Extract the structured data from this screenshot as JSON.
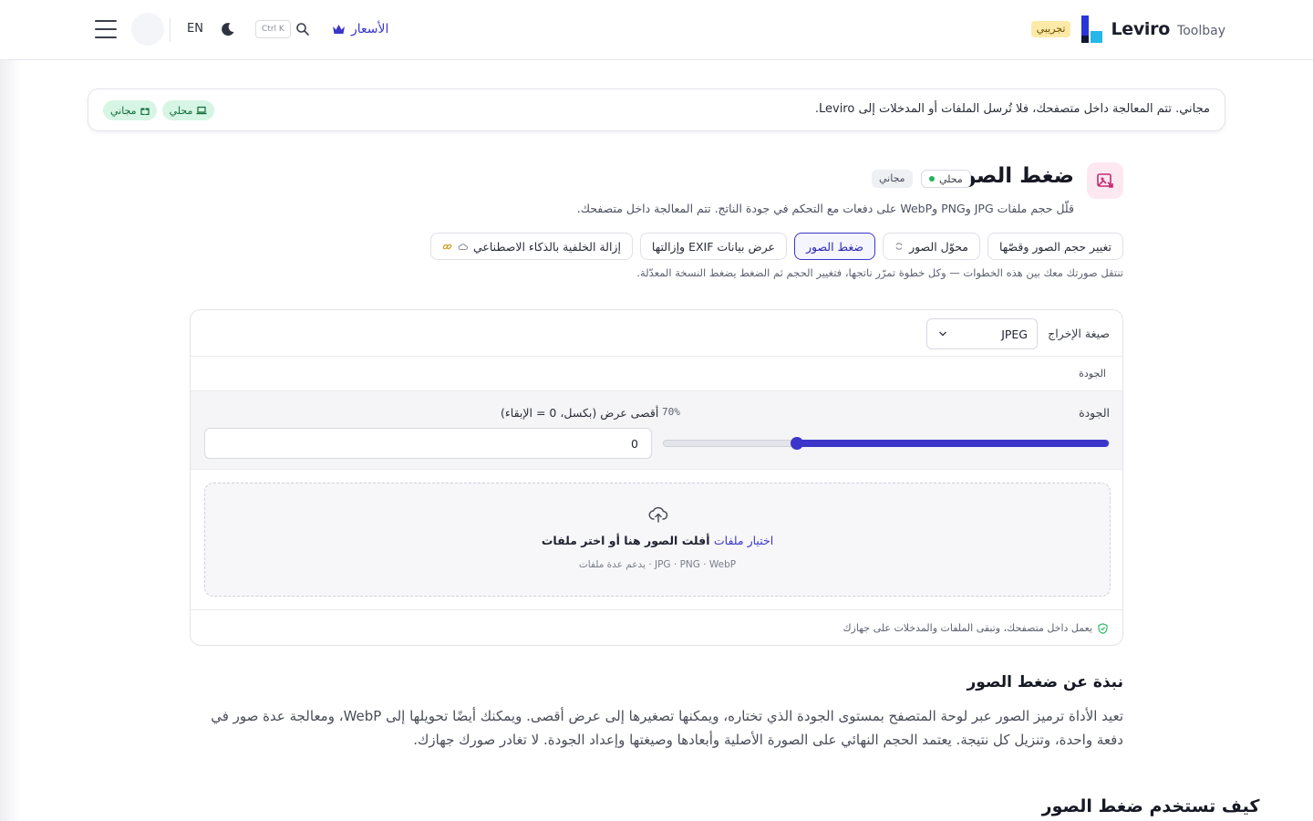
{
  "nav": {
    "lang": "EN",
    "kbd": "Ctrl K",
    "pricing": "الأسعار",
    "brand_name": "Leviro",
    "brand_sub": "Toolbay",
    "trial": "تجريبي"
  },
  "banner": {
    "text": "مجاني. تتم المعالجة داخل متصفحك، فلا تُرسل الملفات أو المدخلات إلى Leviro.",
    "chip_local": "محلي",
    "chip_free": "مجاني"
  },
  "tool": {
    "title": "ضغط الصور",
    "badge_local": "محلي",
    "badge_free": "مجاني",
    "description": "قلّل حجم ملفات JPG وPNG وWebP على دفعات مع التحكم في جودة الناتج. تتم المعالجة داخل متصفحك."
  },
  "steps": [
    {
      "label": "تغيير حجم الصور وقصّها"
    },
    {
      "label": "محوّل الصور"
    },
    {
      "label": "ضغط الصور",
      "active": true
    },
    {
      "label": "عرض بيانات EXIF وإزالتها"
    },
    {
      "label": "إزالة الخلفية بالذكاء الاصطناعي"
    }
  ],
  "steps_note": "تنتقل صورتك معك بين هذه الخطوات — وكل خطوة تمرّر ناتجها، فتغيير الحجم ثم الضغط يضغط النسخة المعدّلة.",
  "settings": {
    "format_label": "صيغة الإخراج",
    "format_value": "JPEG",
    "quality_section": "الجودة",
    "quality_label": "الجودة",
    "quality_value_text": "70%",
    "quality_value": 0.7,
    "max_width_label": "أقصى عرض (بكسل، 0 = الإبقاء)",
    "max_width_value": "0"
  },
  "dropzone": {
    "pick": "اختيار ملفات",
    "main": "أفلت الصور هنا أو اختر ملفات",
    "sub": "JPG · PNG · WebP · يدعم عدة ملفات"
  },
  "card_footer": "يعمل داخل متصفحك، وتبقى الملفات والمدخلات على جهازك",
  "about": {
    "title": "نبذة عن ضغط الصور",
    "body": "تعيد الأداة ترميز الصور عبر لوحة المتصفح بمستوى الجودة الذي تختاره، ويمكنها تصغيرها إلى عرض أقصى. ويمكنك أيضًا تحويلها إلى WebP، ومعالجة عدة صور في دفعة واحدة، وتنزيل كل نتيجة. يعتمد الحجم النهائي على الصورة الأصلية وأبعادها وصيغتها وإعداد الجودة. لا تغادر صورك جهازك."
  },
  "howto": {
    "title": "كيف تستخدم ضغط الصور"
  },
  "colors": {
    "accent": "#3b36c9",
    "success": "#22b35e",
    "trial_bg": "#fde9a8"
  }
}
